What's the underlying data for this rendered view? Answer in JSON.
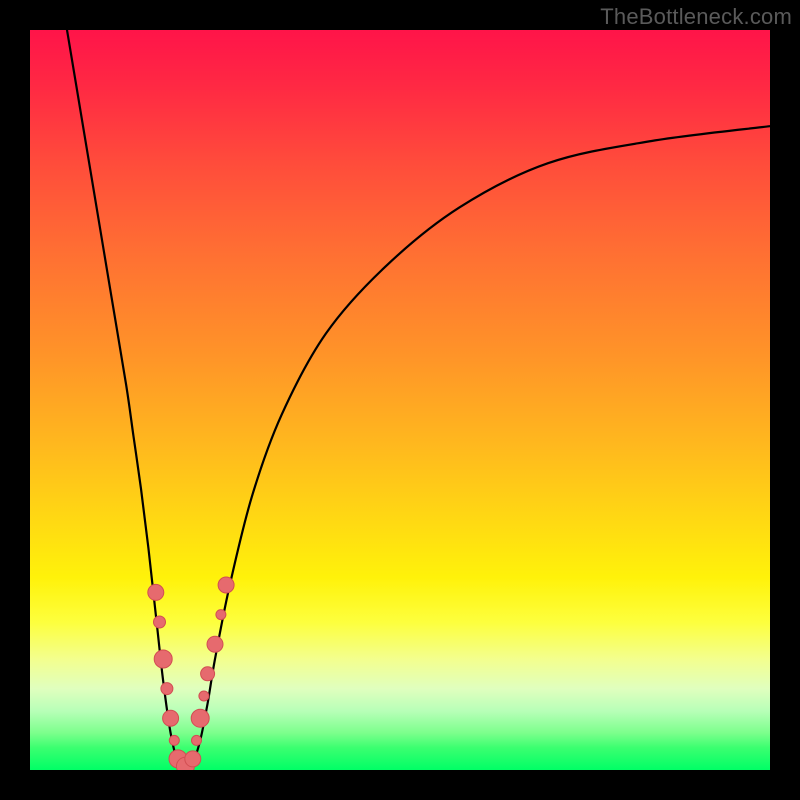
{
  "watermark": "TheBottleneck.com",
  "colors": {
    "frame": "#000000",
    "curve": "#000000",
    "marker_fill": "#e66a6e",
    "marker_stroke": "#d24e52",
    "gradient_top": "#ff1449",
    "gradient_bottom": "#00ff66"
  },
  "chart_data": {
    "type": "line",
    "title": "",
    "xlabel": "",
    "ylabel": "",
    "xlim": [
      0,
      100
    ],
    "ylim": [
      0,
      100
    ],
    "grid": false,
    "legend": "none",
    "series": [
      {
        "name": "bottleneck-curve",
        "x": [
          5,
          7,
          9,
          11,
          13,
          14,
          15,
          16,
          17,
          18,
          19,
          20,
          21,
          22,
          23,
          24,
          25,
          27,
          30,
          34,
          40,
          48,
          58,
          70,
          84,
          100
        ],
        "values": [
          100,
          88,
          76,
          64,
          52,
          45,
          38,
          30,
          21,
          12,
          5,
          1,
          0,
          1,
          4,
          9,
          15,
          25,
          37,
          48,
          59,
          68,
          76,
          82,
          85,
          87
        ]
      }
    ],
    "markers": [
      {
        "x": 17.0,
        "y": 24,
        "r": 8
      },
      {
        "x": 17.5,
        "y": 20,
        "r": 6
      },
      {
        "x": 18.0,
        "y": 15,
        "r": 9
      },
      {
        "x": 18.5,
        "y": 11,
        "r": 6
      },
      {
        "x": 19.0,
        "y": 7,
        "r": 8
      },
      {
        "x": 19.5,
        "y": 4,
        "r": 5
      },
      {
        "x": 20.0,
        "y": 1.5,
        "r": 9
      },
      {
        "x": 21.0,
        "y": 0.5,
        "r": 9
      },
      {
        "x": 22.0,
        "y": 1.5,
        "r": 8
      },
      {
        "x": 22.5,
        "y": 4,
        "r": 5
      },
      {
        "x": 23.0,
        "y": 7,
        "r": 9
      },
      {
        "x": 23.5,
        "y": 10,
        "r": 5
      },
      {
        "x": 24.0,
        "y": 13,
        "r": 7
      },
      {
        "x": 25.0,
        "y": 17,
        "r": 8
      },
      {
        "x": 25.8,
        "y": 21,
        "r": 5
      },
      {
        "x": 26.5,
        "y": 25,
        "r": 8
      }
    ]
  }
}
